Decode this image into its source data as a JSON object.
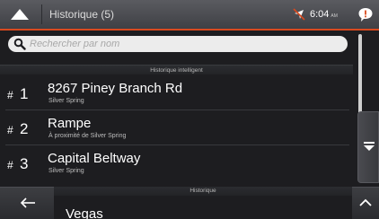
{
  "header": {
    "title": "Historique (5)",
    "time": "6:04",
    "time_suffix": "AM"
  },
  "search": {
    "placeholder": "Rechercher par nom"
  },
  "sections": {
    "smart": "Historique intelligent",
    "history": "Historique"
  },
  "smart_history": [
    {
      "hash": "#",
      "rank": "1",
      "name": "8267 Piney Branch Rd",
      "sub": "Silver Spring"
    },
    {
      "hash": "#",
      "rank": "2",
      "name": "Rampe",
      "sub": "À proximité de Silver Spring"
    },
    {
      "hash": "#",
      "rank": "3",
      "name": "Capital Beltway",
      "sub": "Silver Spring"
    }
  ],
  "history_partial": {
    "name": "Vegas"
  },
  "colors": {
    "accent": "#d94a1f",
    "background": "#1d1d20",
    "search_bg": "#ececec"
  },
  "icons": {
    "up": "chevron-up-icon",
    "gps": "gps-off-icon",
    "messages": "message-bubble-icon",
    "search": "magnifier-icon",
    "scroll_down": "triangle-down-icon",
    "back": "arrow-left-icon",
    "scroll_up": "chevron-up-small-icon"
  }
}
